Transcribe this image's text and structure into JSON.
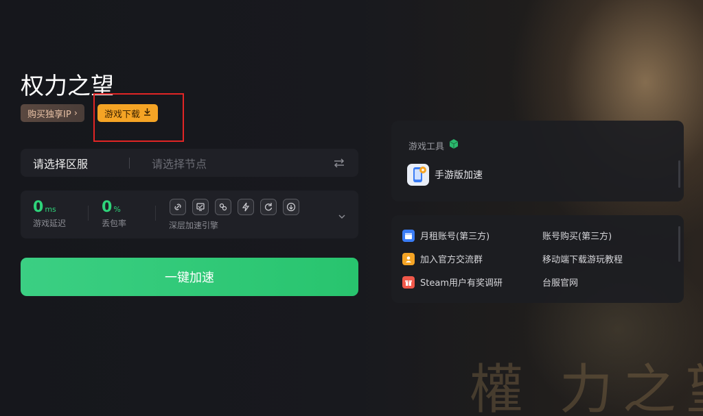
{
  "game": {
    "title": "权力之望",
    "watermark": "權 力之望"
  },
  "tags": {
    "buy_ip": "购买独享IP",
    "buy_ip_arrow": "›",
    "download": "游戏下载",
    "download_arrow": "↓"
  },
  "region_bar": {
    "region_placeholder": "请选择区服",
    "node_placeholder": "请选择节点",
    "swap_icon": "swap-icon"
  },
  "stats": {
    "latency_value": "0",
    "latency_unit": "ms",
    "latency_label": "游戏延迟",
    "loss_value": "0",
    "loss_unit": "%",
    "loss_label": "丢包率",
    "engine_label": "深层加速引擎",
    "engine_icons": [
      "link-icon",
      "screen-icon",
      "network-icon",
      "lightning-icon",
      "refresh-icon",
      "download-icon"
    ]
  },
  "accelerate_button": "一键加速",
  "tools": {
    "title": "游戏工具",
    "mobile_label": "手游版加速"
  },
  "links": {
    "monthly_rent": "月租账号(第三方)",
    "account_buy": "账号购买(第三方)",
    "join_group": "加入官方交流群",
    "mobile_tutorial": "移动端下载游玩教程",
    "steam_survey": "Steam用户有奖调研",
    "tw_site": "台服官网"
  },
  "colors": {
    "accent_green": "#2ed47a",
    "download_orange": "#f5a425",
    "highlight_red": "#e32525"
  }
}
